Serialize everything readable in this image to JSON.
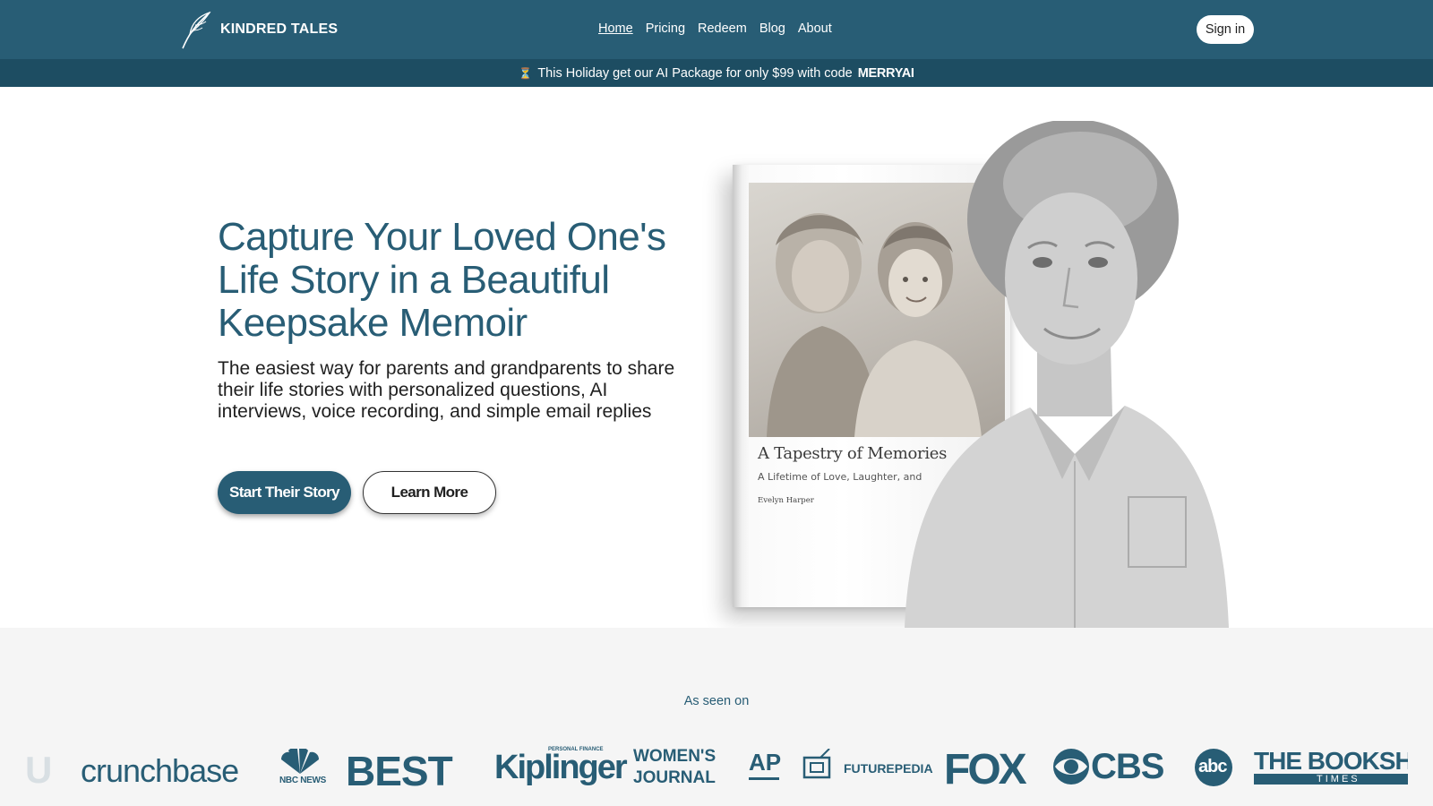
{
  "header": {
    "logo_text": "KINDRED TALES",
    "nav": [
      "Home",
      "Pricing",
      "Redeem",
      "Blog",
      "About"
    ],
    "active_nav": "Home",
    "signin_label": "Sign in"
  },
  "promo": {
    "icon": "hourglass-icon",
    "text": "This Holiday get our AI Package for only $99 with code",
    "code": "MERRYAI"
  },
  "hero": {
    "title": "Capture Your Loved One's Life Story in a Beautiful Keepsake Memoir",
    "subtitle": "The easiest way for parents and grandparents to share their life stories with personalized questions, AI interviews, voice recording, and simple email replies",
    "primary_cta": "Start Their Story",
    "secondary_cta": "Learn More",
    "book": {
      "title": "A Tapestry of Memories",
      "subtitle": "A Lifetime of Love, Laughter, and",
      "author": "Evelyn Harper"
    }
  },
  "press": {
    "label": "As seen on",
    "logos": [
      "crunchbase",
      "NBC NEWS",
      "BEST",
      "Kiplinger",
      "PERSONAL FINANCE",
      "WOMEN'S",
      "JOURNAL",
      "AP",
      "FUTUREPEDIA",
      "FOX",
      "CBS",
      "abc",
      "THE BOOKSH",
      "TIMES"
    ]
  },
  "colors": {
    "primary": "#285d75",
    "promo_bar": "#1d4d62",
    "press_bg": "#f5f5f5"
  }
}
